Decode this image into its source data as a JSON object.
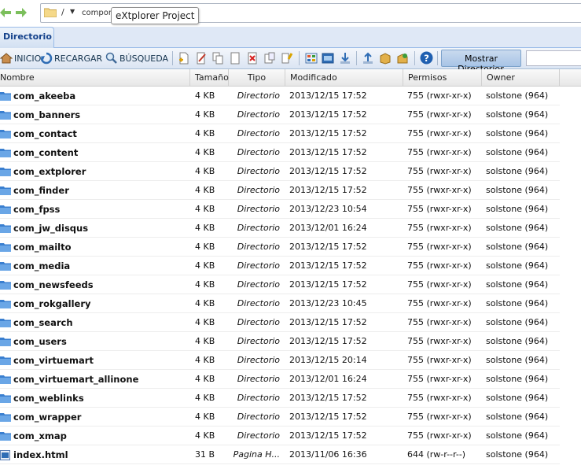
{
  "address": {
    "root_sep": "/",
    "current": "compon",
    "tooltip": "eXtplorer Project"
  },
  "tabs": [
    {
      "label": "Directorio"
    }
  ],
  "toolbar": {
    "home": "INICIO",
    "reload": "RECARGAR",
    "search": "BÚSQUEDA",
    "show_dirs": "Mostrar Directorios"
  },
  "columns": [
    "Nombre",
    "Tamaño",
    "Tipo",
    "Modificado",
    "Permisos",
    "Owner"
  ],
  "rows": [
    {
      "name": "com_akeeba",
      "size": "4 KB",
      "type": "Directorio",
      "modified": "2013/12/15 17:52",
      "perms": "755 (rwxr-xr-x)",
      "owner": "solstone (964)",
      "icon": "folder-icon"
    },
    {
      "name": "com_banners",
      "size": "4 KB",
      "type": "Directorio",
      "modified": "2013/12/15 17:52",
      "perms": "755 (rwxr-xr-x)",
      "owner": "solstone (964)",
      "icon": "folder-icon"
    },
    {
      "name": "com_contact",
      "size": "4 KB",
      "type": "Directorio",
      "modified": "2013/12/15 17:52",
      "perms": "755 (rwxr-xr-x)",
      "owner": "solstone (964)",
      "icon": "folder-icon"
    },
    {
      "name": "com_content",
      "size": "4 KB",
      "type": "Directorio",
      "modified": "2013/12/15 17:52",
      "perms": "755 (rwxr-xr-x)",
      "owner": "solstone (964)",
      "icon": "folder-icon"
    },
    {
      "name": "com_extplorer",
      "size": "4 KB",
      "type": "Directorio",
      "modified": "2013/12/15 17:52",
      "perms": "755 (rwxr-xr-x)",
      "owner": "solstone (964)",
      "icon": "folder-icon"
    },
    {
      "name": "com_finder",
      "size": "4 KB",
      "type": "Directorio",
      "modified": "2013/12/15 17:52",
      "perms": "755 (rwxr-xr-x)",
      "owner": "solstone (964)",
      "icon": "folder-icon"
    },
    {
      "name": "com_fpss",
      "size": "4 KB",
      "type": "Directorio",
      "modified": "2013/12/23 10:54",
      "perms": "755 (rwxr-xr-x)",
      "owner": "solstone (964)",
      "icon": "folder-icon"
    },
    {
      "name": "com_jw_disqus",
      "size": "4 KB",
      "type": "Directorio",
      "modified": "2013/12/01 16:24",
      "perms": "755 (rwxr-xr-x)",
      "owner": "solstone (964)",
      "icon": "folder-icon"
    },
    {
      "name": "com_mailto",
      "size": "4 KB",
      "type": "Directorio",
      "modified": "2013/12/15 17:52",
      "perms": "755 (rwxr-xr-x)",
      "owner": "solstone (964)",
      "icon": "folder-icon"
    },
    {
      "name": "com_media",
      "size": "4 KB",
      "type": "Directorio",
      "modified": "2013/12/15 17:52",
      "perms": "755 (rwxr-xr-x)",
      "owner": "solstone (964)",
      "icon": "folder-icon"
    },
    {
      "name": "com_newsfeeds",
      "size": "4 KB",
      "type": "Directorio",
      "modified": "2013/12/15 17:52",
      "perms": "755 (rwxr-xr-x)",
      "owner": "solstone (964)",
      "icon": "folder-icon"
    },
    {
      "name": "com_rokgallery",
      "size": "4 KB",
      "type": "Directorio",
      "modified": "2013/12/23 10:45",
      "perms": "755 (rwxr-xr-x)",
      "owner": "solstone (964)",
      "icon": "folder-icon"
    },
    {
      "name": "com_search",
      "size": "4 KB",
      "type": "Directorio",
      "modified": "2013/12/15 17:52",
      "perms": "755 (rwxr-xr-x)",
      "owner": "solstone (964)",
      "icon": "folder-icon"
    },
    {
      "name": "com_users",
      "size": "4 KB",
      "type": "Directorio",
      "modified": "2013/12/15 17:52",
      "perms": "755 (rwxr-xr-x)",
      "owner": "solstone (964)",
      "icon": "folder-icon"
    },
    {
      "name": "com_virtuemart",
      "size": "4 KB",
      "type": "Directorio",
      "modified": "2013/12/15 20:14",
      "perms": "755 (rwxr-xr-x)",
      "owner": "solstone (964)",
      "icon": "folder-icon"
    },
    {
      "name": "com_virtuemart_allinone",
      "size": "4 KB",
      "type": "Directorio",
      "modified": "2013/12/01 16:24",
      "perms": "755 (rwxr-xr-x)",
      "owner": "solstone (964)",
      "icon": "folder-icon"
    },
    {
      "name": "com_weblinks",
      "size": "4 KB",
      "type": "Directorio",
      "modified": "2013/12/15 17:52",
      "perms": "755 (rwxr-xr-x)",
      "owner": "solstone (964)",
      "icon": "folder-icon"
    },
    {
      "name": "com_wrapper",
      "size": "4 KB",
      "type": "Directorio",
      "modified": "2013/12/15 17:52",
      "perms": "755 (rwxr-xr-x)",
      "owner": "solstone (964)",
      "icon": "folder-icon"
    },
    {
      "name": "com_xmap",
      "size": "4 KB",
      "type": "Directorio",
      "modified": "2013/12/15 17:52",
      "perms": "755 (rwxr-xr-x)",
      "owner": "solstone (964)",
      "icon": "folder-icon"
    },
    {
      "name": "index.html",
      "size": "31 B",
      "type": "Pagina H...",
      "modified": "2013/11/06 16:36",
      "perms": "644 (rw-r--r--)",
      "owner": "solstone (964)",
      "icon": "html-file-icon"
    }
  ],
  "colors": {
    "accent": "#15428b",
    "tab_bg": "#dfe8f6",
    "folder": "#3a7fd0",
    "nav_arrow": "#6aa84f"
  }
}
